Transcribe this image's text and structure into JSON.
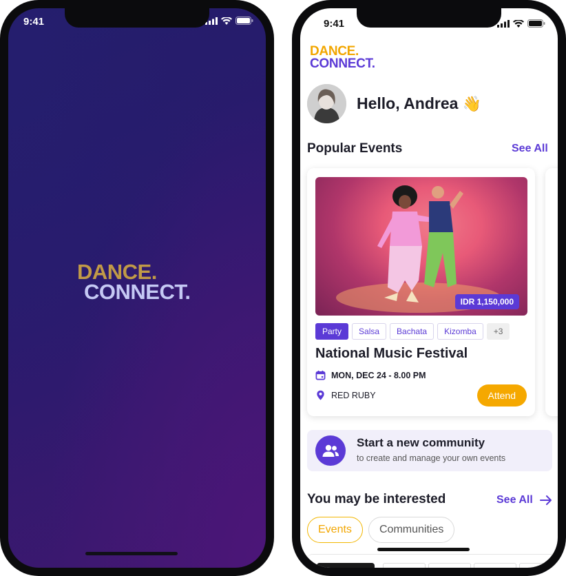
{
  "status_bar": {
    "time": "9:41"
  },
  "splash": {
    "logo_line1": "DANCE.",
    "logo_line2": "CONNECT."
  },
  "app": {
    "logo_line1": "DANCE.",
    "logo_line2": "CONNECT.",
    "greeting": "Hello, Andrea",
    "greeting_emoji": "👋"
  },
  "popular_events": {
    "title": "Popular Events",
    "see_all": "See All",
    "event": {
      "price": "IDR 1,150,000",
      "tags": [
        "Party",
        "Salsa",
        "Bachata",
        "Kizomba",
        "+3"
      ],
      "name": "National Music Festival",
      "date": "MON, DEC 24 - 8.00 PM",
      "venue": "RED RUBY",
      "attend_label": "Attend"
    }
  },
  "community_banner": {
    "title": "Start a new community",
    "subtitle": "to create and manage your own events"
  },
  "interested": {
    "title": "You may be interested",
    "see_all": "See All",
    "filters": [
      "Events",
      "Communities"
    ]
  },
  "colors": {
    "brand_purple": "#5b3ad6",
    "brand_gold": "#f2a600",
    "splash_bg": "#2a1b6d"
  }
}
